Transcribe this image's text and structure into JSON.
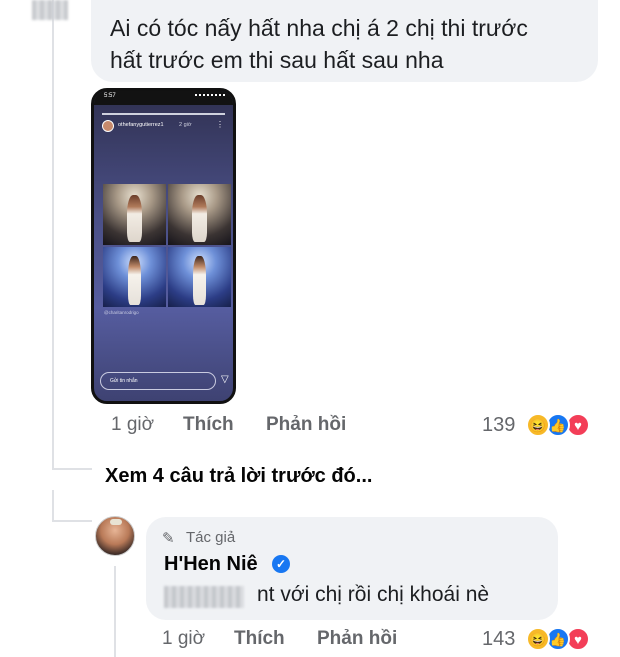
{
  "comment1": {
    "text_line1": "Ai có tóc nấy hất nha chị á 2 chị thi trước",
    "text_line2": "hất trước em thi sau hất sau nha",
    "story": {
      "time": "5:57",
      "username": "othefanygutierrez1",
      "age": "2 giờ",
      "caption": "@charitanrodrigo",
      "reply_placeholder": "Gửi tin nhắn"
    },
    "actions": {
      "time": "1 giờ",
      "like": "Thích",
      "reply": "Phản hồi"
    },
    "reaction_count": "139"
  },
  "view_more": "Xem 4 câu trả lời trước đó...",
  "comment2": {
    "author_tag": "Tác giả",
    "author_name": "H'Hen Niê",
    "text": "nt với chị rồi chị khoái nè",
    "actions": {
      "time": "1 giờ",
      "like": "Thích",
      "reply": "Phản hồi"
    },
    "reaction_count": "143"
  },
  "icons": {
    "reactions": [
      "haha-icon",
      "like-icon",
      "love-icon"
    ],
    "verified": "verified-badge-icon",
    "author": "pen-icon"
  },
  "colors": {
    "bubble": "#f0f2f5",
    "muted_text": "#65676b",
    "like_blue": "#1877f2",
    "love_red": "#f33e58",
    "haha_yellow": "#f7b928"
  }
}
